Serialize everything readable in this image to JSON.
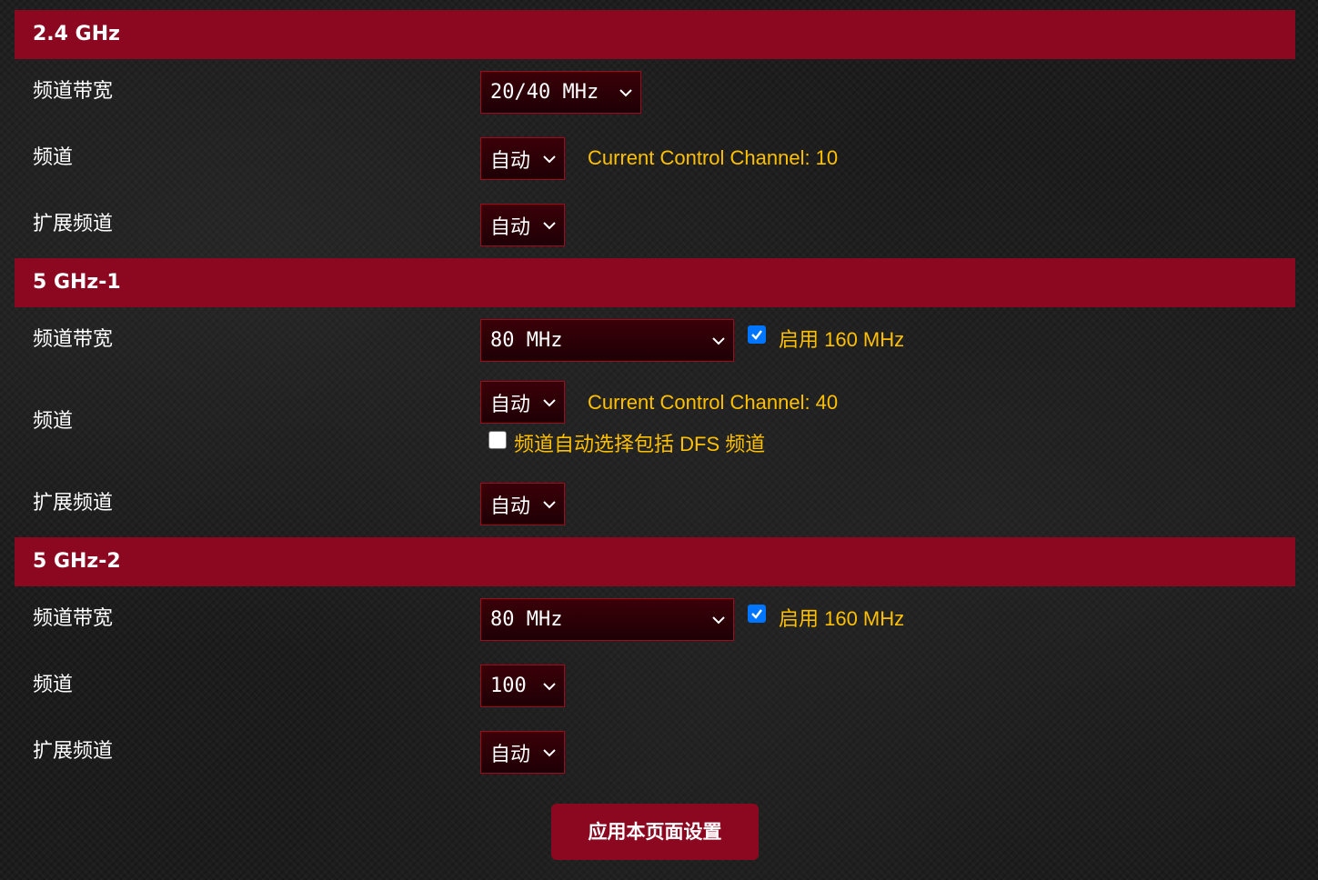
{
  "sections": [
    {
      "title": "2.4 GHz",
      "bandwidth": {
        "label": "频道带宽",
        "value": "20/40 MHz"
      },
      "channel": {
        "label": "频道",
        "value": "自动",
        "current_control_channel": "Current Control Channel: 10"
      },
      "ext_channel": {
        "label": "扩展频道",
        "value": "自动"
      }
    },
    {
      "title": "5 GHz-1",
      "bandwidth": {
        "label": "频道带宽",
        "value": "80 MHz",
        "enable_160": {
          "label": "启用 160 MHz",
          "checked": true
        }
      },
      "channel": {
        "label": "频道",
        "value": "自动",
        "current_control_channel": "Current Control Channel: 40",
        "dfs_option": {
          "label": "频道自动选择包括 DFS 频道",
          "checked": false
        }
      },
      "ext_channel": {
        "label": "扩展频道",
        "value": "自动"
      }
    },
    {
      "title": "5 GHz-2",
      "bandwidth": {
        "label": "频道带宽",
        "value": "80 MHz",
        "enable_160": {
          "label": "启用 160 MHz",
          "checked": true
        }
      },
      "channel": {
        "label": "频道",
        "value": "100"
      },
      "ext_channel": {
        "label": "扩展频道",
        "value": "自动"
      }
    }
  ],
  "apply_button": {
    "label": "应用本页面设置"
  },
  "colors": {
    "header_bg": "#8c0820",
    "select_border": "#a2091f",
    "note_text": "#ffc000",
    "checkbox_checked": "#0075ff",
    "page_bg": "#1c1c1c"
  },
  "icons": {
    "select_arrow": "chevron-down-icon",
    "checkmark": "checkmark-icon"
  }
}
